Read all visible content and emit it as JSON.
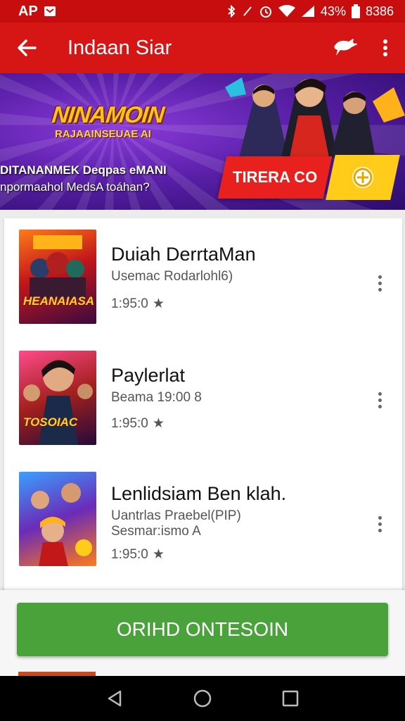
{
  "status_bar": {
    "left_text": "AP",
    "battery_text": "43%",
    "time": "8386"
  },
  "app_bar": {
    "title": "Indaan Siar"
  },
  "banner": {
    "logo_title": "NINAMOIN",
    "logo_subtitle": "RAJAAINSEUAE AI",
    "line1": "DITANANMEK Deqpas eMANI",
    "line2": "npormaahol MedsA toáhan?",
    "cta_label": "TIRERA CO"
  },
  "list": {
    "items": [
      {
        "thumb_label": "HEANAIASA",
        "title": "Duiah DerrtaMan",
        "subtitle": "Usemac Rodarlohl6)",
        "subtitle2": "",
        "rating": "1:95:0"
      },
      {
        "thumb_label": "TOSOIAC",
        "title": "Paylerlat",
        "subtitle": "Beama 19:00 8",
        "subtitle2": "",
        "rating": "1:95:0"
      },
      {
        "thumb_label": "",
        "title": "Lenlidsiam Ben klah.",
        "subtitle": "Uantrlas Praebel(PIP)",
        "subtitle2": "Sesmar:ismo A",
        "rating": "1:95:0"
      }
    ]
  },
  "install_button": {
    "label": "ORIHD ONTESOIN"
  },
  "colors": {
    "header_red": "#d61515",
    "status_red": "#c70d0d",
    "install_green": "#49a23a"
  }
}
